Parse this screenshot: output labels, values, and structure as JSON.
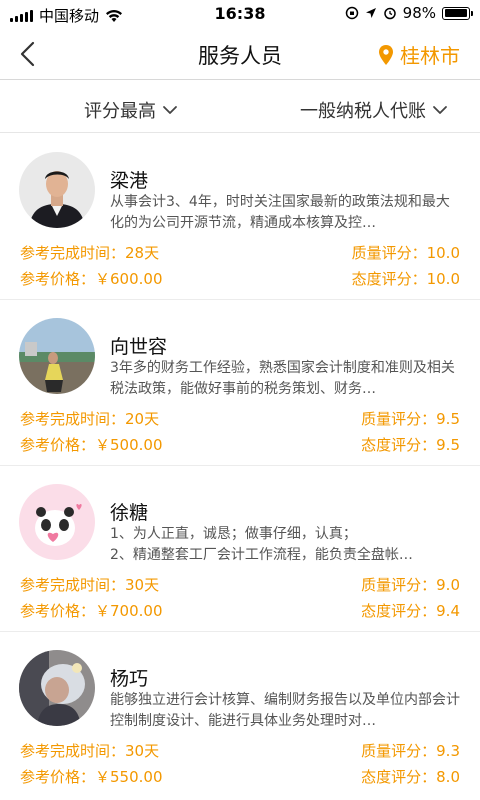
{
  "status_bar": {
    "carrier": "中国移动",
    "time": "16:38",
    "battery": "98%",
    "battery_level": 0.98
  },
  "nav": {
    "title": "服务人员",
    "city": "桂林市"
  },
  "filters": {
    "sort": "评分最高",
    "type": "一般纳税人代账"
  },
  "colors": {
    "accent": "#f39800",
    "divider": "#ececec"
  },
  "staff": [
    {
      "name": "梁港",
      "desc": "    从事会计3、4年，时时关注国家最新的政策法规和最大化的为公司开源节流，精通成本核算及控…",
      "time_label": "参考完成时间：",
      "time": "28天",
      "price_label": "参考价格：",
      "price": "￥600.00",
      "quality_label": "质量评分：",
      "quality": "10.0",
      "attitude_label": "态度评分：",
      "attitude": "10.0"
    },
    {
      "name": "向世容",
      "desc": "3年多的财务工作经验，熟悉国家会计制度和准则及相关税法政策，能做好事前的税务策划、财务…",
      "time_label": "参考完成时间：",
      "time": "20天",
      "price_label": "参考价格：",
      "price": "￥500.00",
      "quality_label": "质量评分：",
      "quality": "9.5",
      "attitude_label": "态度评分：",
      "attitude": "9.5"
    },
    {
      "name": "徐糖",
      "desc": "1、为人正直，诚恳；做事仔细，认真；\n2、精通整套工厂会计工作流程，能负责全盘帐…",
      "time_label": "参考完成时间：",
      "time": "30天",
      "price_label": "参考价格：",
      "price": "￥700.00",
      "quality_label": "质量评分：",
      "quality": "9.0",
      "attitude_label": "态度评分：",
      "attitude": "9.4"
    },
    {
      "name": "杨巧",
      "desc": "能够独立进行会计核算、编制财务报告以及单位内部会计控制制度设计、能进行具体业务处理时对…",
      "time_label": "参考完成时间：",
      "time": "30天",
      "price_label": "参考价格：",
      "price": "￥550.00",
      "quality_label": "质量评分：",
      "quality": "9.3",
      "attitude_label": "态度评分：",
      "attitude": "8.0"
    }
  ]
}
